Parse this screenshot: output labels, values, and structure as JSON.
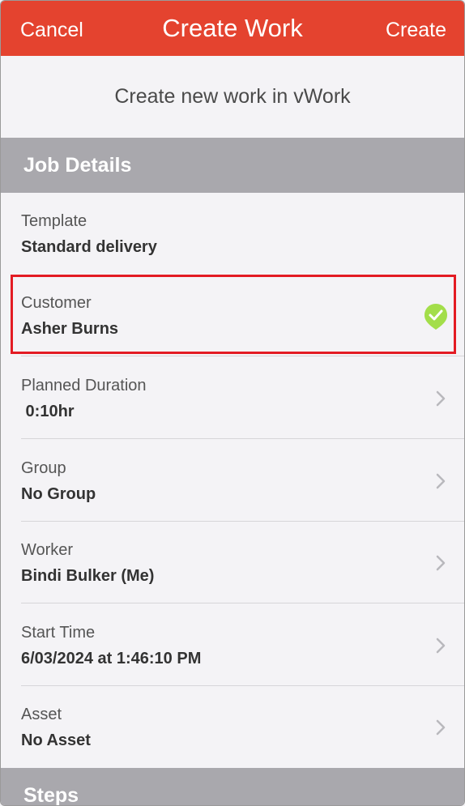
{
  "navbar": {
    "cancel_label": "Cancel",
    "title": "Create Work",
    "create_label": "Create"
  },
  "subtitle": "Create new work in vWork",
  "sections": {
    "job_details": "Job Details",
    "steps": "Steps"
  },
  "rows": [
    {
      "label": "Template",
      "value": "Standard delivery"
    },
    {
      "label": "Customer",
      "value": "Asher Burns",
      "icon": "checkmark-icon",
      "highlighted": true
    },
    {
      "label": "Planned Duration",
      "value": " 0:10hr",
      "icon": "chevron-right-icon"
    },
    {
      "label": "Group",
      "value": "No Group",
      "icon": "chevron-right-icon"
    },
    {
      "label": "Worker",
      "value": "Bindi Bulker (Me)",
      "icon": "chevron-right-icon"
    },
    {
      "label": "Start Time",
      "value": "6/03/2024 at 1:46:10 PM",
      "icon": "chevron-right-icon"
    },
    {
      "label": "Asset",
      "value": "No Asset",
      "icon": "chevron-right-icon"
    }
  ],
  "colors": {
    "accent": "#e4432f",
    "section_bg": "#a9a8ad",
    "check": "#a3de4a",
    "highlight": "#e31b23"
  }
}
